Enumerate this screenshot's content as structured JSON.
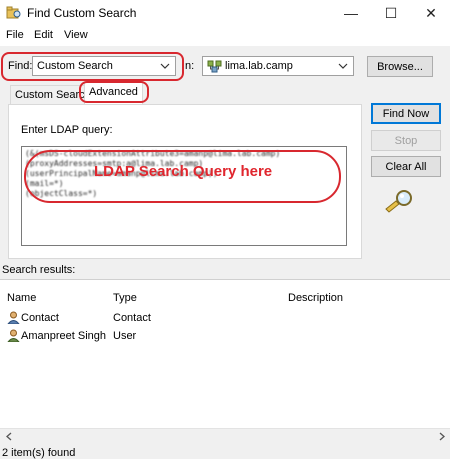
{
  "window": {
    "title": "Find Custom Search",
    "controls": {
      "minimize": "—",
      "maximize": "☐",
      "close": "✕"
    }
  },
  "menu": [
    "File",
    "Edit",
    "View"
  ],
  "find_row": {
    "find_label": "Find:",
    "find_value": "Custom Search",
    "in_label": "In:",
    "in_visible_label": "n:",
    "in_value": "lima.lab.camp",
    "browse_label": "Browse..."
  },
  "tabs": [
    {
      "label": "Custom Search",
      "active": false
    },
    {
      "label": "Advanced",
      "active": true
    }
  ],
  "advanced": {
    "query_label": "Enter LDAP query:",
    "overlay": "LDAP Search Query here"
  },
  "buttons": {
    "find_now": "Find Now",
    "stop": "Stop",
    "clear_all": "Clear All"
  },
  "results": {
    "label": "Search results:",
    "columns": [
      "Name",
      "Type",
      "Description"
    ],
    "rows": [
      {
        "name": "Contact",
        "type": "Contact",
        "description": ""
      },
      {
        "name": "Amanpreet Singh",
        "type": "User",
        "description": ""
      }
    ]
  },
  "status": "2 item(s) found",
  "colors": {
    "highlight": "#d8282f",
    "accent": "#0078d7"
  }
}
